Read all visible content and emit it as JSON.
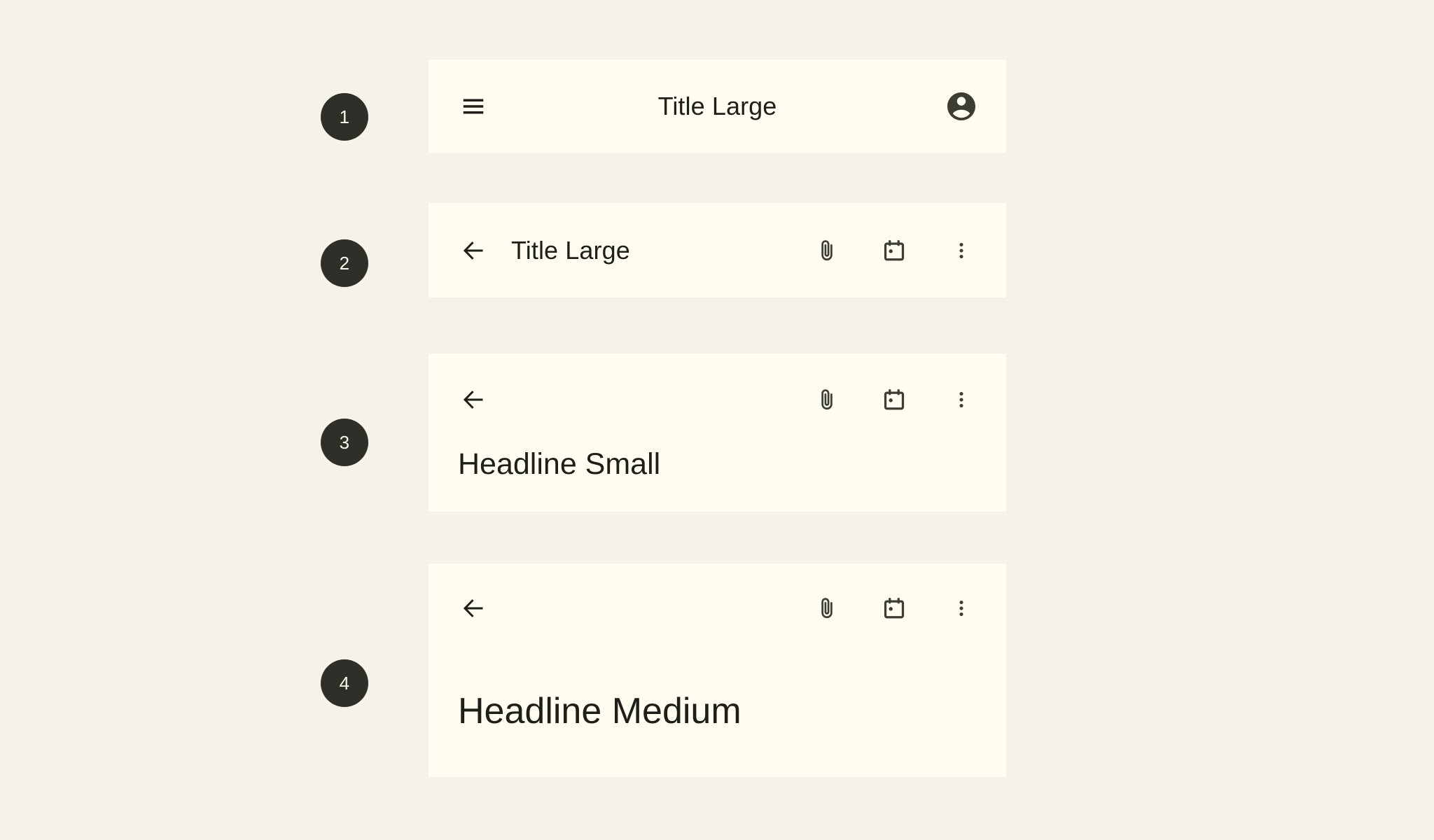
{
  "page": {
    "background_color": "#F5F2E9",
    "card_color": "#FFFDF0",
    "text_color": "#1F1E17",
    "badge_color": "#302E28",
    "badge_text_color": "#FBF9EF"
  },
  "specimens": [
    {
      "step": "1",
      "variant": "center-aligned-top-app-bar",
      "title": "Title Large",
      "leading_icon": "menu-icon",
      "trailing_icons": [
        "account-circle-icon"
      ]
    },
    {
      "step": "2",
      "variant": "small-top-app-bar",
      "title": "Title Large",
      "leading_icon": "back-arrow-icon",
      "trailing_icons": [
        "attach-file-icon",
        "calendar-today-icon",
        "more-vert-icon"
      ]
    },
    {
      "step": "3",
      "variant": "medium-top-app-bar",
      "title": "Headline Small",
      "leading_icon": "back-arrow-icon",
      "trailing_icons": [
        "attach-file-icon",
        "calendar-today-icon",
        "more-vert-icon"
      ]
    },
    {
      "step": "4",
      "variant": "large-top-app-bar",
      "title": "Headline Medium",
      "leading_icon": "back-arrow-icon",
      "trailing_icons": [
        "attach-file-icon",
        "calendar-today-icon",
        "more-vert-icon"
      ]
    }
  ]
}
